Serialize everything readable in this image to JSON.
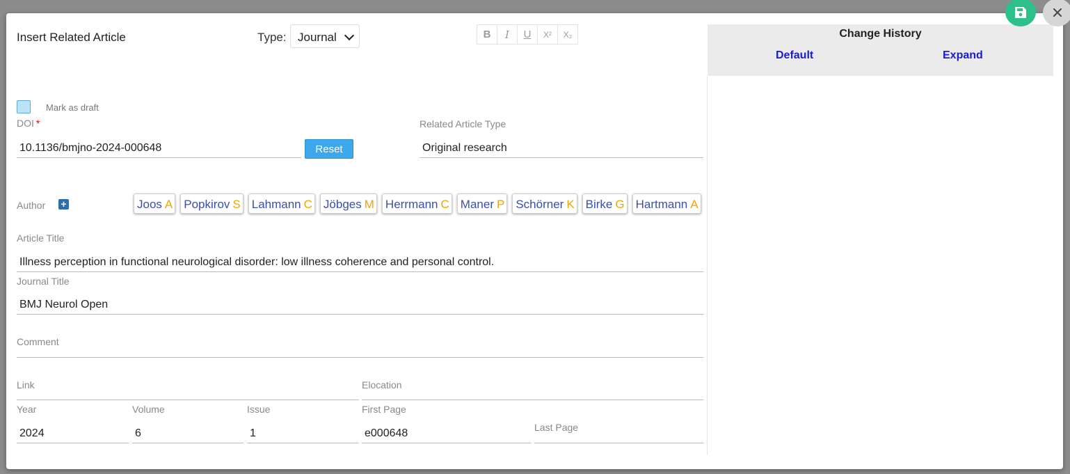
{
  "modal": {
    "title": "Insert Related Article",
    "type_label": "Type:",
    "type_value": "Journal",
    "format_buttons": [
      "B",
      "I",
      "U",
      "X²",
      "X₂"
    ],
    "draft_label": "Mark as draft",
    "doi": {
      "label": "DOI",
      "required_mark": "*",
      "value": "10.1136/bmjno-2024-000648",
      "reset_label": "Reset"
    },
    "related_type": {
      "label": "Related Article Type",
      "value": "Original research"
    },
    "author_label": "Author",
    "add_author_label": "+",
    "authors": [
      {
        "surname": "Joos",
        "initials": "A"
      },
      {
        "surname": "Popkirov",
        "initials": "S"
      },
      {
        "surname": "Lahmann",
        "initials": "C"
      },
      {
        "surname": "Jöbges",
        "initials": "M"
      },
      {
        "surname": "Herrmann",
        "initials": "C"
      },
      {
        "surname": "Maner",
        "initials": "P"
      },
      {
        "surname": "Schörner",
        "initials": "K"
      },
      {
        "surname": "Birke",
        "initials": "G"
      },
      {
        "surname": "Hartmann",
        "initials": "A"
      }
    ],
    "article_title": {
      "label": "Article Title",
      "value": "Illness perception in functional neurological disorder: low illness coherence and personal control."
    },
    "journal_title": {
      "label": "Journal Title",
      "value": "BMJ Neurol Open"
    },
    "comment": {
      "label": "Comment",
      "value": ""
    },
    "link": {
      "label": "Link",
      "value": ""
    },
    "elocation": {
      "label": "Elocation",
      "value": ""
    },
    "year": {
      "label": "Year",
      "value": "2024"
    },
    "volume": {
      "label": "Volume",
      "value": "6"
    },
    "issue": {
      "label": "Issue",
      "value": "1"
    },
    "first_page": {
      "label": "First Page",
      "value": "e000648"
    },
    "last_page": {
      "label": "Last Page",
      "value": ""
    }
  },
  "history": {
    "title": "Change History",
    "default_label": "Default",
    "expand_label": "Expand"
  },
  "icons": {
    "save": "save-icon",
    "close": "close-icon",
    "add": "plus-icon"
  },
  "colors": {
    "accent": "#3ea8ed",
    "author_surname": "#3b4fa8",
    "author_initials": "#f0a500",
    "save_fab": "#2ec08b",
    "history_link": "#1a1ad6"
  }
}
